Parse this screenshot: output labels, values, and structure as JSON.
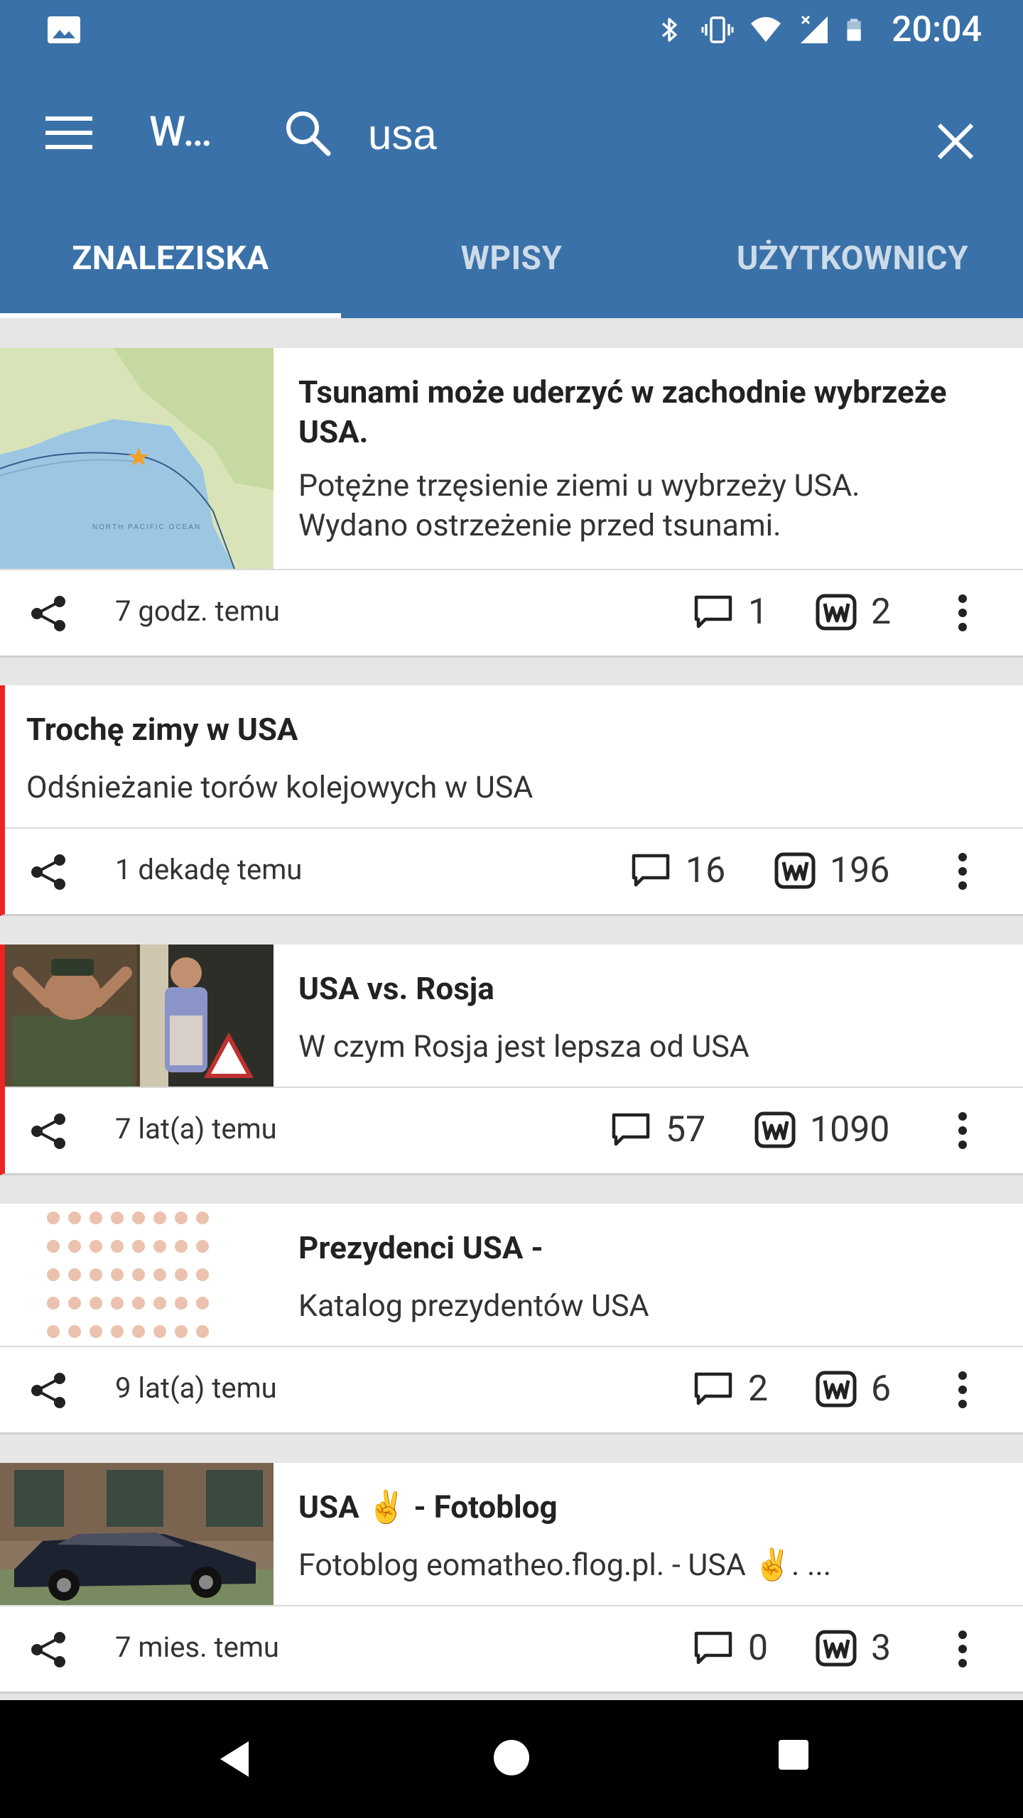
{
  "status_bar": {
    "time": "20:04"
  },
  "app_bar": {
    "title": "W…",
    "search_value": "usa"
  },
  "tabs": [
    {
      "label": "ZNALEZISKA",
      "active": true
    },
    {
      "label": "WPISY",
      "active": false
    },
    {
      "label": "UŻYTKOWNICY",
      "active": false
    }
  ],
  "cards": [
    {
      "title_line1": "Tsunami może uderzyć w zachodnie wybrzeże",
      "title_line2": "USA.",
      "desc_line1": "Potężne trzęsienie ziemi u wybrzeży USA.",
      "desc_line2": "Wydano ostrzeżenie przed tsunami.",
      "time": "7 godz. temu",
      "comments": "1",
      "votes": "2",
      "thumbnail": "map-thumbnail",
      "flagged": false
    },
    {
      "title": "Trochę zimy w USA",
      "desc": "Odśnieżanie torów kolejowych w USA",
      "time": "1 dekadę temu",
      "comments": "16",
      "votes": "196",
      "flagged": true
    },
    {
      "title": "USA vs. Rosja",
      "desc": "W czym Rosja jest lepsza od USA",
      "time": "7 lat(a) temu",
      "comments": "57",
      "votes": "1090",
      "thumbnail": "photo-thumbnail",
      "flagged": true
    },
    {
      "title": "Prezydenci USA -",
      "desc": "Katalog prezydentów USA",
      "time": "9 lat(a) temu",
      "comments": "2",
      "votes": "6",
      "thumbnail": "portraits-thumbnail",
      "flagged": false
    },
    {
      "title": "USA ✌️ - Fotoblog",
      "desc": "Fotoblog eomatheo.flog.pl. - USA ✌️. ...",
      "time": "7 mies. temu",
      "comments": "0",
      "votes": "3",
      "thumbnail": "car-thumbnail",
      "flagged": false
    }
  ],
  "colors": {
    "primary": "#3a71a8",
    "flag": "#ee2424",
    "background": "#e6e6e6"
  }
}
